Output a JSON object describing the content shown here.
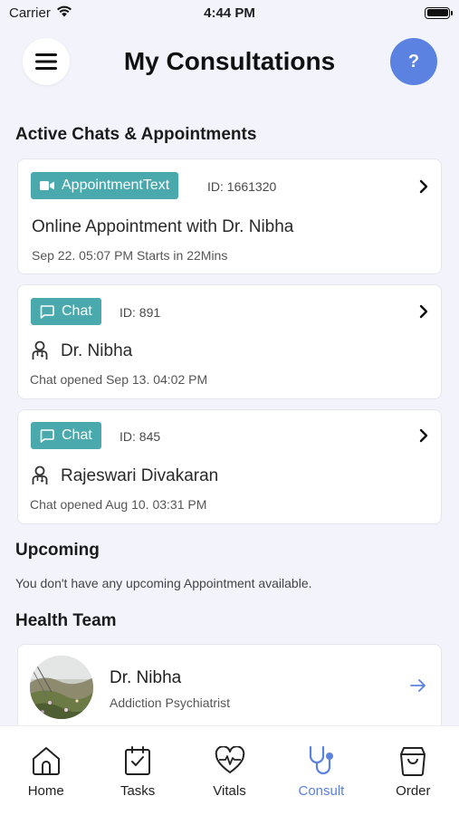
{
  "status_bar": {
    "carrier": "Carrier",
    "time": "4:44 PM"
  },
  "header": {
    "title": "My Consultations",
    "help_label": "?"
  },
  "sections": {
    "active": "Active Chats & Appointments",
    "upcoming": "Upcoming",
    "upcoming_empty": "You don't have any upcoming Appointment available.",
    "health_team": "Health Team"
  },
  "cards": [
    {
      "tag": "AppointmentText",
      "tag_icon": "video-camera-icon",
      "id": "ID: 1661320",
      "title": "Online Appointment with Dr. Nibha",
      "sub": "Sep 22. 05:07 PM  Starts in 22Mins"
    },
    {
      "tag": "Chat",
      "tag_icon": "chat-bubble-icon",
      "id": "ID: 891",
      "title": "Dr. Nibha",
      "sub": "Chat opened Sep 13. 04:02 PM"
    },
    {
      "tag": "Chat",
      "tag_icon": "chat-bubble-icon",
      "id": "ID: 845",
      "title": "Rajeswari Divakaran",
      "sub": "Chat opened Aug 10. 03:31 PM"
    }
  ],
  "health_team": [
    {
      "name": "Dr. Nibha",
      "role": "Addiction Psychiatrist"
    }
  ],
  "nav": [
    {
      "label": "Home",
      "icon": "home-icon"
    },
    {
      "label": "Tasks",
      "icon": "tasks-icon"
    },
    {
      "label": "Vitals",
      "icon": "vitals-icon"
    },
    {
      "label": "Consult",
      "icon": "stethoscope-icon",
      "active": true
    },
    {
      "label": "Order",
      "icon": "shopping-bag-icon"
    }
  ],
  "colors": {
    "accent": "#5b82e0",
    "tag": "#4aa9ad",
    "background": "#f2f3fb"
  }
}
